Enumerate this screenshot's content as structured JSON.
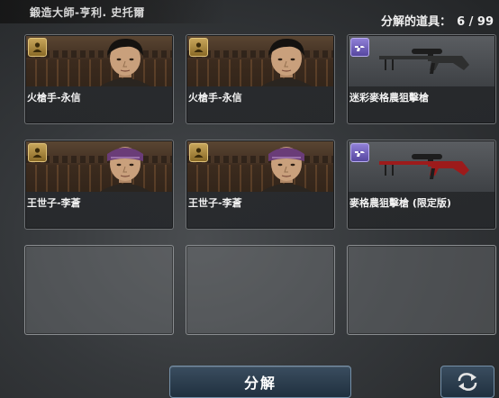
{
  "header": {
    "title": "鍛造大師-亨利. 史托爾",
    "count_label": "分解的道具：",
    "count_value": "6 / 99"
  },
  "items": [
    {
      "name": "火槍手-永信",
      "kind": "character",
      "icon": "character-icon",
      "theme": "dark-hair"
    },
    {
      "name": "火槍手-永信",
      "kind": "character",
      "icon": "character-icon",
      "theme": "dark-hair"
    },
    {
      "name": "迷彩麥格農狙擊槍",
      "kind": "weapon",
      "icon": "revolver-icon",
      "color": "#2e2f2f"
    },
    {
      "name": "王世子-李蒼",
      "kind": "character",
      "icon": "character-icon",
      "theme": "headband"
    },
    {
      "name": "王世子-李蒼",
      "kind": "character",
      "icon": "character-icon",
      "theme": "headband"
    },
    {
      "name": "麥格農狙擊槍 (限定版)",
      "kind": "weapon",
      "icon": "revolver-icon",
      "color": "#9d1b1b"
    },
    {
      "name": "",
      "kind": "empty"
    },
    {
      "name": "",
      "kind": "empty"
    },
    {
      "name": "",
      "kind": "empty"
    }
  ],
  "buttons": {
    "disassemble_label": "分解",
    "refresh_icon": "refresh-arrows-icon"
  }
}
